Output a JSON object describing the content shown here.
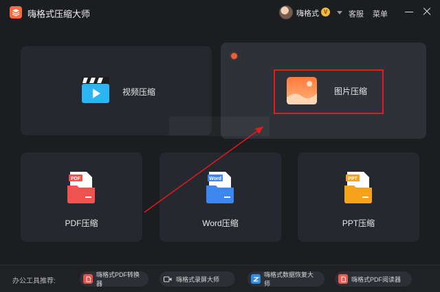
{
  "app": {
    "title": "嗨格式压缩大师",
    "user": {
      "name": "嗨格式",
      "vip_badge": "V"
    },
    "service_label": "客服",
    "menu_label": "菜单"
  },
  "cards": {
    "video": {
      "label": "视频压缩",
      "icon": "video-clapper-icon",
      "color": "#29b6f6"
    },
    "image": {
      "label": "图片压缩",
      "icon": "image-landscape-icon",
      "color": "#ff8a50",
      "selected": true
    },
    "pdf": {
      "label": "PDF压缩",
      "icon": "pdf-folder-icon",
      "badge": "PDF",
      "color": "#f0524f"
    },
    "word": {
      "label": "Word压缩",
      "icon": "word-folder-icon",
      "badge": "Word",
      "color": "#3d86f0"
    },
    "ppt": {
      "label": "PPT压缩",
      "icon": "ppt-folder-icon",
      "badge": "PPT",
      "color": "#f7a21b"
    }
  },
  "footer": {
    "label": "办公工具推荐:",
    "tools": [
      {
        "label": "嗨格式PDF转换器",
        "icon": "pdf-converter-icon",
        "color": "#e8504c"
      },
      {
        "label": "嗨格式录屏大师",
        "icon": "screen-record-icon",
        "color": "#5a5f68"
      },
      {
        "label": "嗨格式数据恢复大师",
        "icon": "data-recovery-icon",
        "color": "#2f8de4"
      },
      {
        "label": "嗨格式PDF阅读器",
        "icon": "pdf-reader-icon",
        "color": "#ee5a4e"
      }
    ]
  },
  "annotation": {
    "highlight_color": "#e21b1b",
    "arrow_color": "#e21b1b"
  }
}
